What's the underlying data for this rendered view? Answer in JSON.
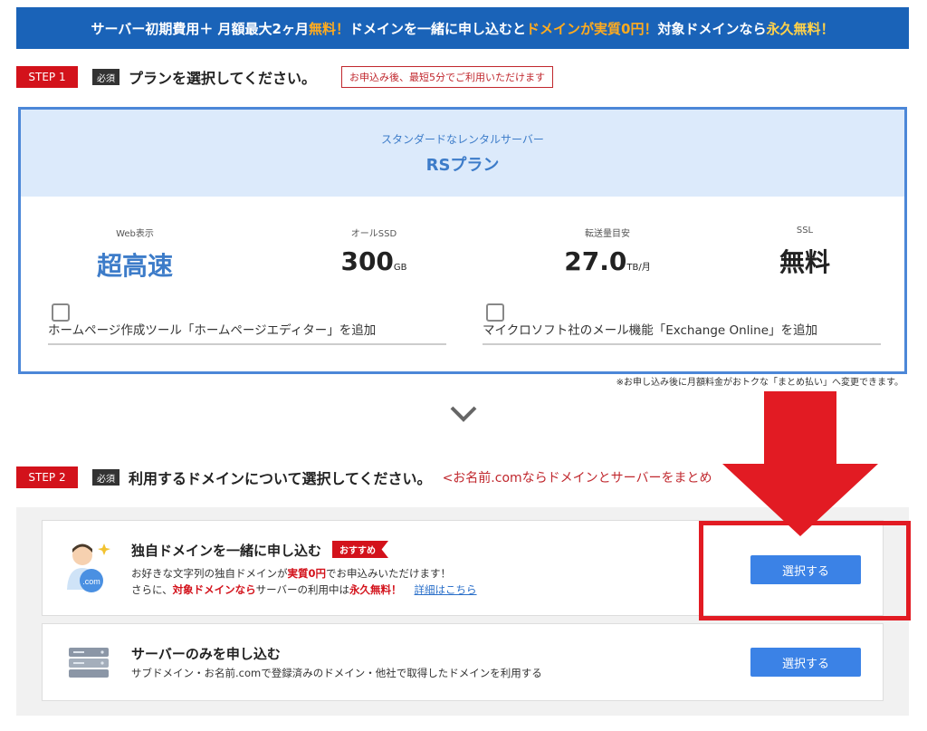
{
  "banner": {
    "part1": "サーバー初期費用＋ 月額最大2ヶ月",
    "part2": "無料！",
    "part3": "ドメインを一緒に申し込むと",
    "part4": "ドメインが実質0円！",
    "part5": "対象ドメインなら",
    "part6": "永久無料！"
  },
  "step1": {
    "badge": "STEP 1",
    "required": "必須",
    "title": "プランを選択してください。",
    "note": "お申込み後、最短5分でご利用いただけます"
  },
  "plan": {
    "subtitle": "スタンダードなレンタルサーバー",
    "name": "RSプラン",
    "specs": [
      {
        "label": "Web表示",
        "value": "超高速",
        "unit": ""
      },
      {
        "label": "オールSSD",
        "value": "300",
        "unit": "GB"
      },
      {
        "label": "転送量目安",
        "value": "27.0",
        "unit": "TB/月"
      },
      {
        "label": "SSL",
        "value": "無料",
        "unit": ""
      }
    ],
    "options": [
      {
        "label": "ホームページ作成ツール「ホームページエディター」を追加"
      },
      {
        "label": "マイクロソフト社のメール機能「Exchange Online」を追加"
      }
    ],
    "note": "※お申し込み後に月額料金がおトクな「まとめ払い」へ変更できます。"
  },
  "step2": {
    "badge": "STEP 2",
    "required": "必須",
    "title": "利用するドメインについて選択してください。",
    "subtitle": "<お名前.comならドメインとサーバーをまとめ"
  },
  "domain_options": [
    {
      "title": "独自ドメインを一緒に申し込む",
      "ribbon": "おすすめ",
      "line1_a": "お好きな文字列の独自ドメインが",
      "line1_b": "実質0円",
      "line1_c": "でお申込みいただけます！",
      "line2_a": "さらに、",
      "line2_b": "対象ドメインなら",
      "line2_c": "サーバーの利用中は",
      "line2_d": "永久無料！",
      "link": "詳細はこちら",
      "button": "選択する",
      "icon_text": ".com"
    },
    {
      "title": "サーバーのみを申し込む",
      "line1": "サブドメイン・お名前.comで登録済みのドメイン・他社で取得したドメインを利用する",
      "button": "選択する"
    }
  ],
  "colors": {
    "accent": "#1a63b8",
    "step": "#d3121b",
    "button": "#3b82e6",
    "highlight_frame": "#e21b23"
  }
}
